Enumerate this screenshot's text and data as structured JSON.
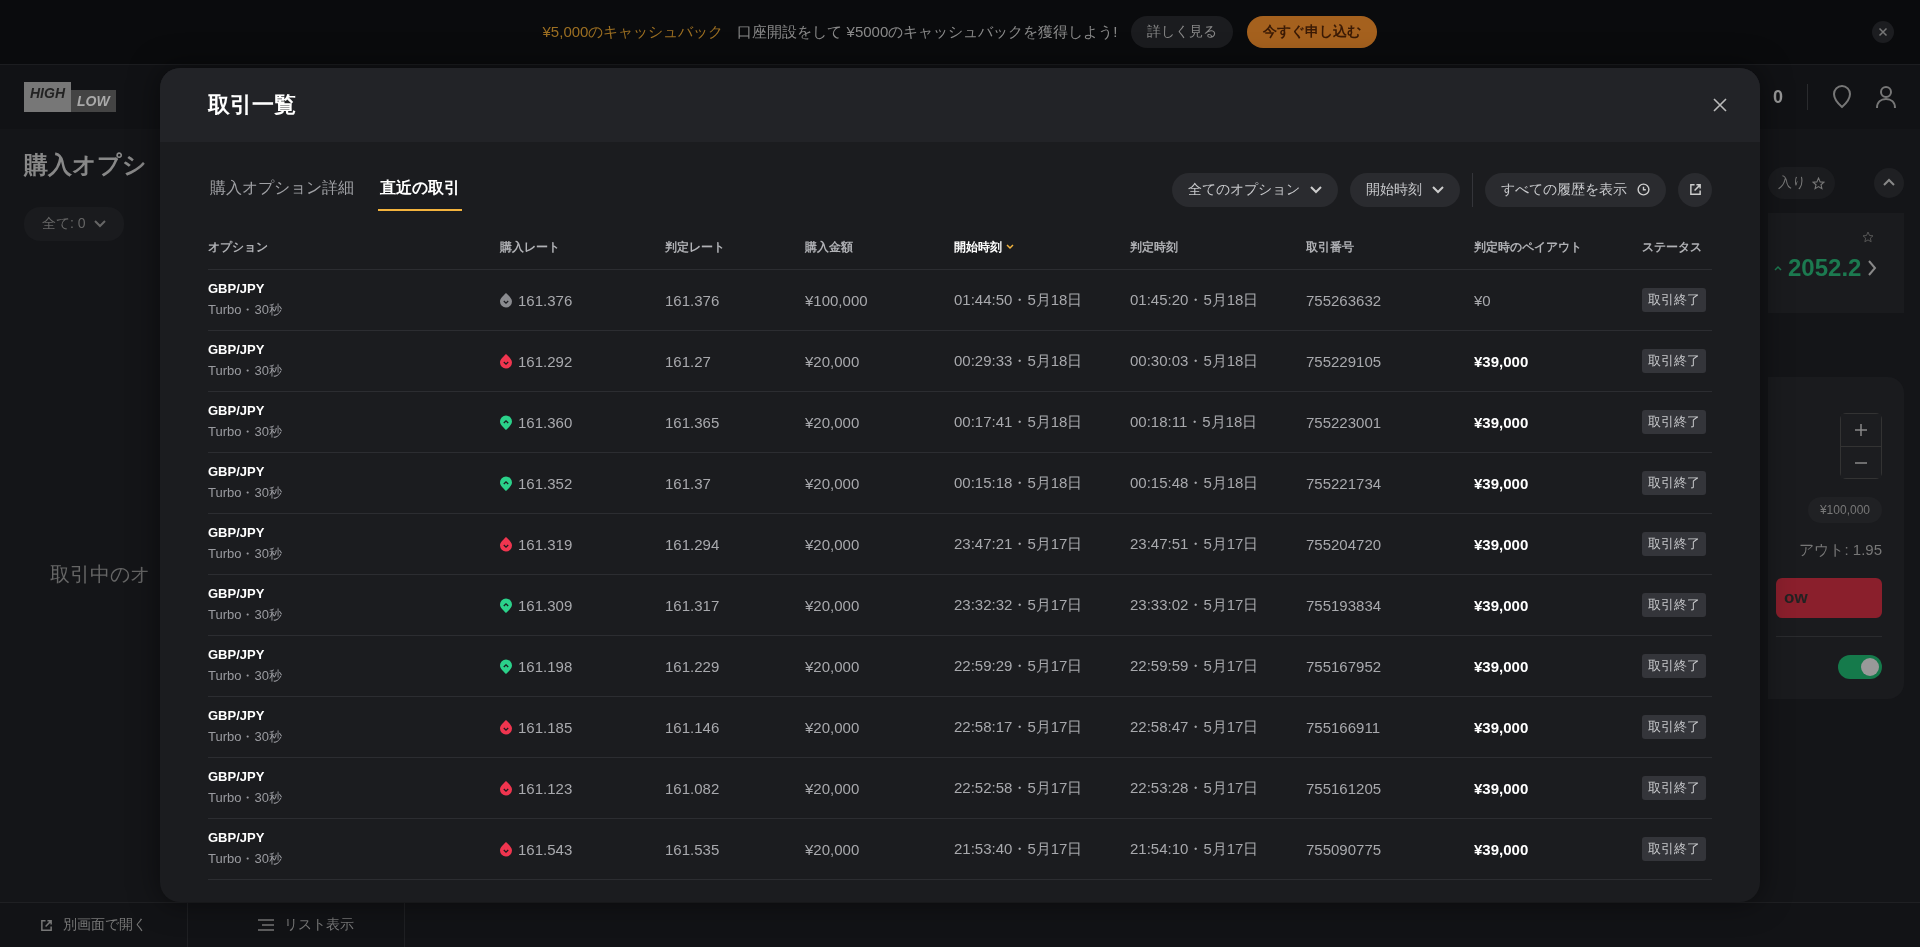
{
  "banner": {
    "promo": "¥5,000のキャッシュバック",
    "message": "口座開設をして ¥5000のキャッシュバックを獲得しよう!",
    "details_button": "詳しく見る",
    "apply_button": "今すぐ申し込む"
  },
  "header": {
    "logo_high": "HIGH",
    "logo_low": "LOW",
    "balance": "0"
  },
  "left_panel": {
    "title": "購入オプシ",
    "filter": "全て: 0",
    "empty_message": "取引中のオ"
  },
  "right_panel": {
    "favorites": "入り",
    "price": "2052.2",
    "amount_chip": "¥100,000",
    "payout": "アウト: 1.95",
    "low_button": "ow",
    "toggle_on": true
  },
  "bottom_bar": {
    "open_window": "別画面で開く",
    "list_view": "リスト表示"
  },
  "modal": {
    "title": "取引一覧",
    "tabs": [
      {
        "label": "購入オプション詳細",
        "selected": false
      },
      {
        "label": "直近の取引",
        "selected": true
      }
    ],
    "filters": [
      "全てのオプション",
      "開始時刻"
    ],
    "history_button": "すべての履歴を表示",
    "columns": [
      {
        "label": "オプション",
        "sorted": false
      },
      {
        "label": "購入レート",
        "sorted": false
      },
      {
        "label": "判定レート",
        "sorted": false
      },
      {
        "label": "購入金額",
        "sorted": false
      },
      {
        "label": "開始時刻",
        "sorted": true
      },
      {
        "label": "判定時刻",
        "sorted": false
      },
      {
        "label": "取引番号",
        "sorted": false
      },
      {
        "label": "判定時のペイアウト",
        "sorted": false
      },
      {
        "label": "ステータス",
        "sorted": false
      }
    ],
    "rows": [
      {
        "asset": "GBP/JPY",
        "type": "Turbo・30秒",
        "high": false,
        "won": false,
        "purchase_rate": "161.376",
        "closing_rate": "161.376",
        "amount": "¥100,000",
        "start": "01:44:50・5月18日",
        "end": "01:45:20・5月18日",
        "trade_id": "755263632",
        "payout": "¥0",
        "status": "取引終了"
      },
      {
        "asset": "GBP/JPY",
        "type": "Turbo・30秒",
        "high": false,
        "won": true,
        "purchase_rate": "161.292",
        "closing_rate": "161.27",
        "amount": "¥20,000",
        "start": "00:29:33・5月18日",
        "end": "00:30:03・5月18日",
        "trade_id": "755229105",
        "payout": "¥39,000",
        "status": "取引終了"
      },
      {
        "asset": "GBP/JPY",
        "type": "Turbo・30秒",
        "high": true,
        "won": true,
        "purchase_rate": "161.360",
        "closing_rate": "161.365",
        "amount": "¥20,000",
        "start": "00:17:41・5月18日",
        "end": "00:18:11・5月18日",
        "trade_id": "755223001",
        "payout": "¥39,000",
        "status": "取引終了"
      },
      {
        "asset": "GBP/JPY",
        "type": "Turbo・30秒",
        "high": true,
        "won": true,
        "purchase_rate": "161.352",
        "closing_rate": "161.37",
        "amount": "¥20,000",
        "start": "00:15:18・5月18日",
        "end": "00:15:48・5月18日",
        "trade_id": "755221734",
        "payout": "¥39,000",
        "status": "取引終了"
      },
      {
        "asset": "GBP/JPY",
        "type": "Turbo・30秒",
        "high": false,
        "won": true,
        "purchase_rate": "161.319",
        "closing_rate": "161.294",
        "amount": "¥20,000",
        "start": "23:47:21・5月17日",
        "end": "23:47:51・5月17日",
        "trade_id": "755204720",
        "payout": "¥39,000",
        "status": "取引終了"
      },
      {
        "asset": "GBP/JPY",
        "type": "Turbo・30秒",
        "high": true,
        "won": true,
        "purchase_rate": "161.309",
        "closing_rate": "161.317",
        "amount": "¥20,000",
        "start": "23:32:32・5月17日",
        "end": "23:33:02・5月17日",
        "trade_id": "755193834",
        "payout": "¥39,000",
        "status": "取引終了"
      },
      {
        "asset": "GBP/JPY",
        "type": "Turbo・30秒",
        "high": true,
        "won": true,
        "purchase_rate": "161.198",
        "closing_rate": "161.229",
        "amount": "¥20,000",
        "start": "22:59:29・5月17日",
        "end": "22:59:59・5月17日",
        "trade_id": "755167952",
        "payout": "¥39,000",
        "status": "取引終了"
      },
      {
        "asset": "GBP/JPY",
        "type": "Turbo・30秒",
        "high": false,
        "won": true,
        "purchase_rate": "161.185",
        "closing_rate": "161.146",
        "amount": "¥20,000",
        "start": "22:58:17・5月17日",
        "end": "22:58:47・5月17日",
        "trade_id": "755166911",
        "payout": "¥39,000",
        "status": "取引終了"
      },
      {
        "asset": "GBP/JPY",
        "type": "Turbo・30秒",
        "high": false,
        "won": true,
        "purchase_rate": "161.123",
        "closing_rate": "161.082",
        "amount": "¥20,000",
        "start": "22:52:58・5月17日",
        "end": "22:53:28・5月17日",
        "trade_id": "755161205",
        "payout": "¥39,000",
        "status": "取引終了"
      },
      {
        "asset": "GBP/JPY",
        "type": "Turbo・30秒",
        "high": false,
        "won": true,
        "purchase_rate": "161.543",
        "closing_rate": "161.535",
        "amount": "¥20,000",
        "start": "21:53:40・5月17日",
        "end": "21:54:10・5月17日",
        "trade_id": "755090775",
        "payout": "¥39,000",
        "status": "取引終了"
      }
    ]
  }
}
